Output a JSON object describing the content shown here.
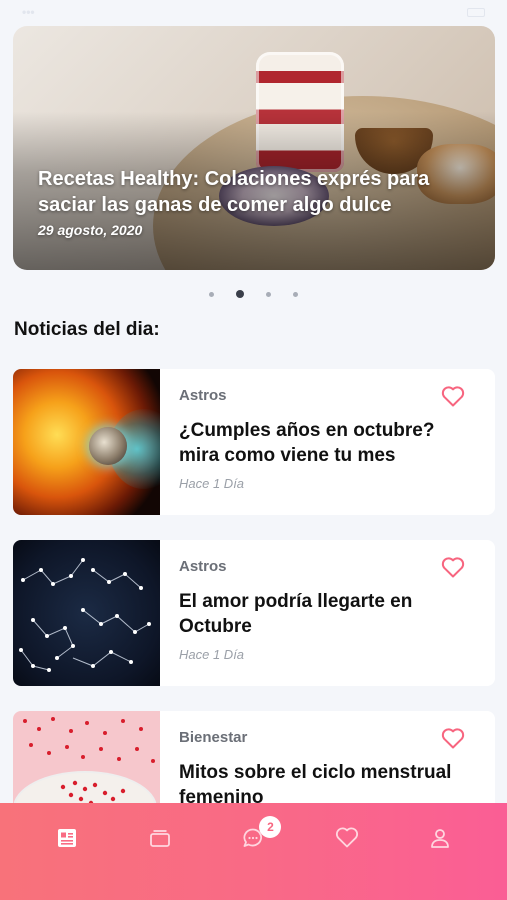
{
  "featured": {
    "title": "Recetas Healthy: Colaciones exprés para saciar las ganas de comer algo dulce",
    "date": "29 agosto, 2020",
    "page_count": 4,
    "active_page": 2
  },
  "section_title": "Noticias del dia:",
  "news": [
    {
      "category": "Astros",
      "headline": "¿Cumples años en octubre? mira como viene tu mes",
      "time": "Hace 1 Día"
    },
    {
      "category": "Astros",
      "headline": "El amor podría llegarte en Octubre",
      "time": "Hace 1 Día"
    },
    {
      "category": "Bienestar",
      "headline": "Mitos sobre el ciclo menstrual femenino",
      "time": ""
    }
  ],
  "tabbar": {
    "items": [
      "news-icon",
      "cards-icon",
      "chat-icon",
      "heart-icon",
      "profile-icon"
    ],
    "chat_badge": "2"
  },
  "colors": {
    "accent": "#f7657f",
    "tabbar_start": "#f8727a",
    "tabbar_end": "#fa5e95"
  }
}
